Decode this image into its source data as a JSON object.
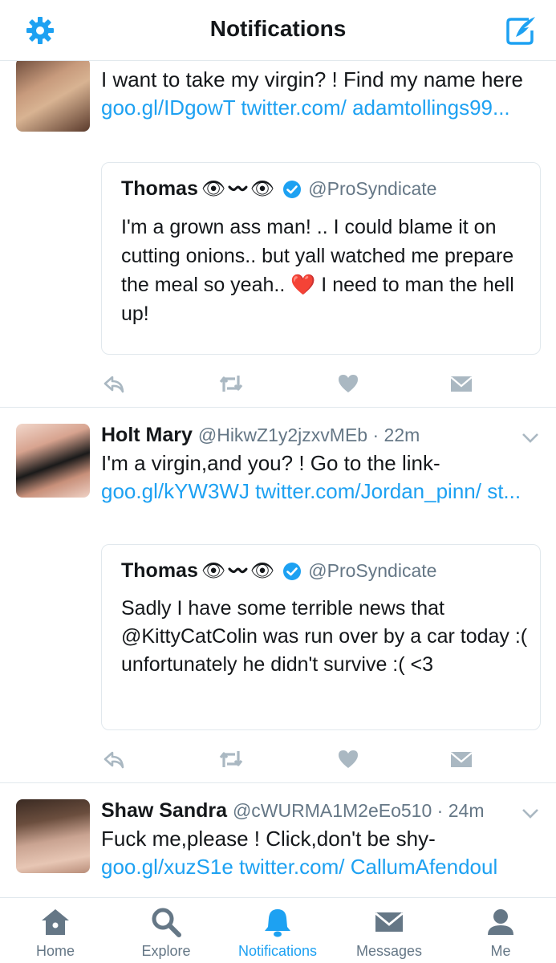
{
  "header": {
    "title": "Notifications",
    "settings_icon": "gear-icon",
    "compose_icon": "compose-tweet-icon"
  },
  "colors": {
    "accent": "#1da1f2",
    "text": "#14171a",
    "muted": "#657786",
    "like": "#aab8c2",
    "heart_emoji": "#e0245e"
  },
  "tweets": [
    {
      "author_name": "",
      "author_handle": "",
      "time": "",
      "text": "I want to take my virgin? !  Find my name here  ",
      "links": "goo.gl/IDgowT twitter.com/ adamtollings99...",
      "quote": {
        "name": "Thomas",
        "emoji": "👁〰👁",
        "handle": "@ProSyndicate",
        "text": "I'm a grown ass man! .. I could blame it on cutting onions.. but yall watched me prepare the meal so yeah.. ❤️ I need to man the hell up!"
      }
    },
    {
      "author_name": "Holt Mary",
      "author_handle": "@HikwZ1y2jzxvMEb",
      "time": "22m",
      "text": "I'm a virgin,and you? !  Go to the link-",
      "links": "goo.gl/kYW3WJ twitter.com/Jordan_pinn/ st...",
      "quote": {
        "name": "Thomas",
        "emoji": "👁〰👁",
        "handle": "@ProSyndicate",
        "text": "Sadly I have some terrible news that @KittyCatColin was run over by a car today :( unfortunately he didn't survive :( <3"
      }
    },
    {
      "author_name": "Shaw Sandra",
      "author_handle": "@cWURMA1M2eEo510",
      "time": "24m",
      "text": "Fuck me,please ! Click,don't be shy-",
      "links": "goo.gl/xuzS1e twitter.com/ CallumAfendoul"
    }
  ],
  "tabbar": {
    "home": "Home",
    "explore": "Explore",
    "notifications": "Notifications",
    "messages": "Messages",
    "me": "Me",
    "active": "notifications"
  }
}
